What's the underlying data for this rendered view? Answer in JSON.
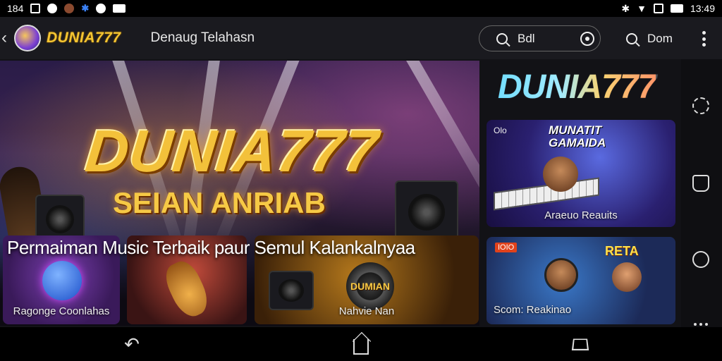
{
  "status_bar": {
    "left_text": "184",
    "time": "13:49"
  },
  "app_bar": {
    "brand": "DUNIA777",
    "nav_title": "Denaug Telahasn",
    "search_text": "Bdl",
    "secondary_search_text": "Dom"
  },
  "hero": {
    "title": "DUNIA777",
    "subtitle": "SEIAN ANRIAB"
  },
  "section": {
    "heading": "Permaiman Music Terbaik paur Semul Kalankalnyaa"
  },
  "cards": [
    {
      "label": "Ragonge Coonlahas"
    },
    {
      "label": ""
    },
    {
      "label": "Nahvie Nan",
      "overlay_title": "DUMIAN"
    }
  ],
  "right_panel": {
    "logo": "DUNIA777",
    "card_top": {
      "tiny": "Olo",
      "title_line1": "MUNATIT",
      "title_line2": "GAMAIDA",
      "caption": "Araeuo Reauits"
    },
    "card_bottom": {
      "tag": "IOIO",
      "title": "RETA",
      "caption": "Scom: Reakinao"
    }
  },
  "colors": {
    "accent_gold": "#f3c13a",
    "logo_cyan": "#3ad0ff",
    "background": "#121216"
  }
}
